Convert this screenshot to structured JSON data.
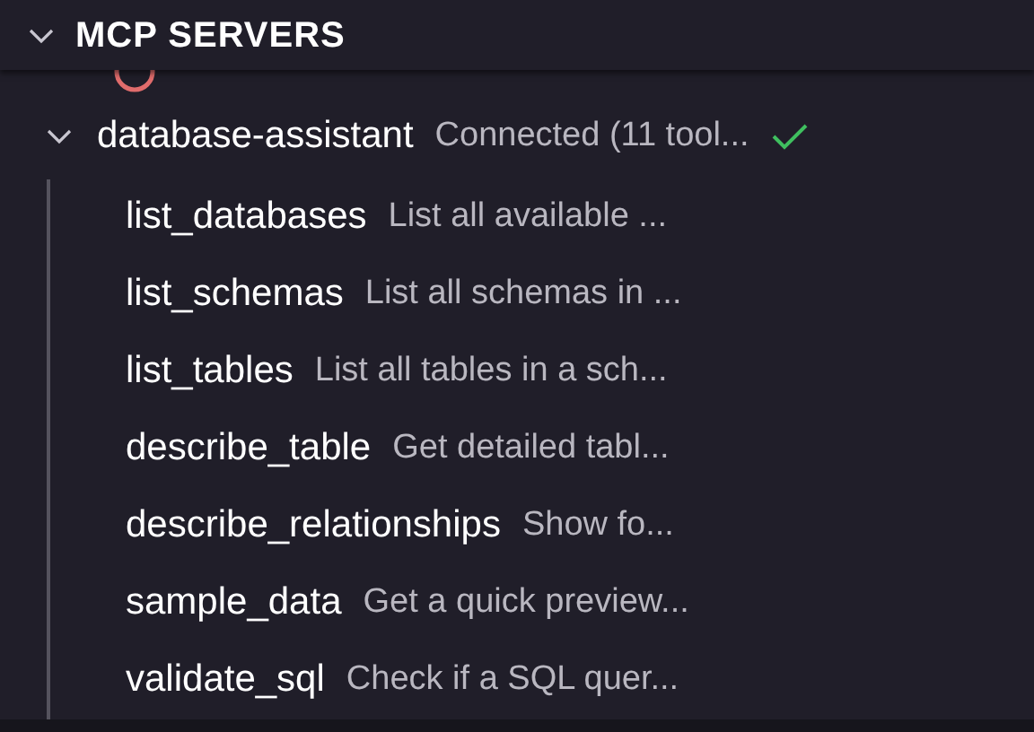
{
  "section": {
    "title": "MCP SERVERS",
    "expanded": true
  },
  "server": {
    "name": "database-assistant",
    "status": "Connected (11 tool...",
    "expanded": true,
    "connected": true
  },
  "tools": [
    {
      "name": "list_databases",
      "description": "List all available ..."
    },
    {
      "name": "list_schemas",
      "description": "List all schemas in ..."
    },
    {
      "name": "list_tables",
      "description": "List all tables in a sch..."
    },
    {
      "name": "describe_table",
      "description": "Get detailed tabl..."
    },
    {
      "name": "describe_relationships",
      "description": "Show fo..."
    },
    {
      "name": "sample_data",
      "description": "Get a quick preview..."
    },
    {
      "name": "validate_sql",
      "description": "Check if a SQL quer..."
    }
  ]
}
